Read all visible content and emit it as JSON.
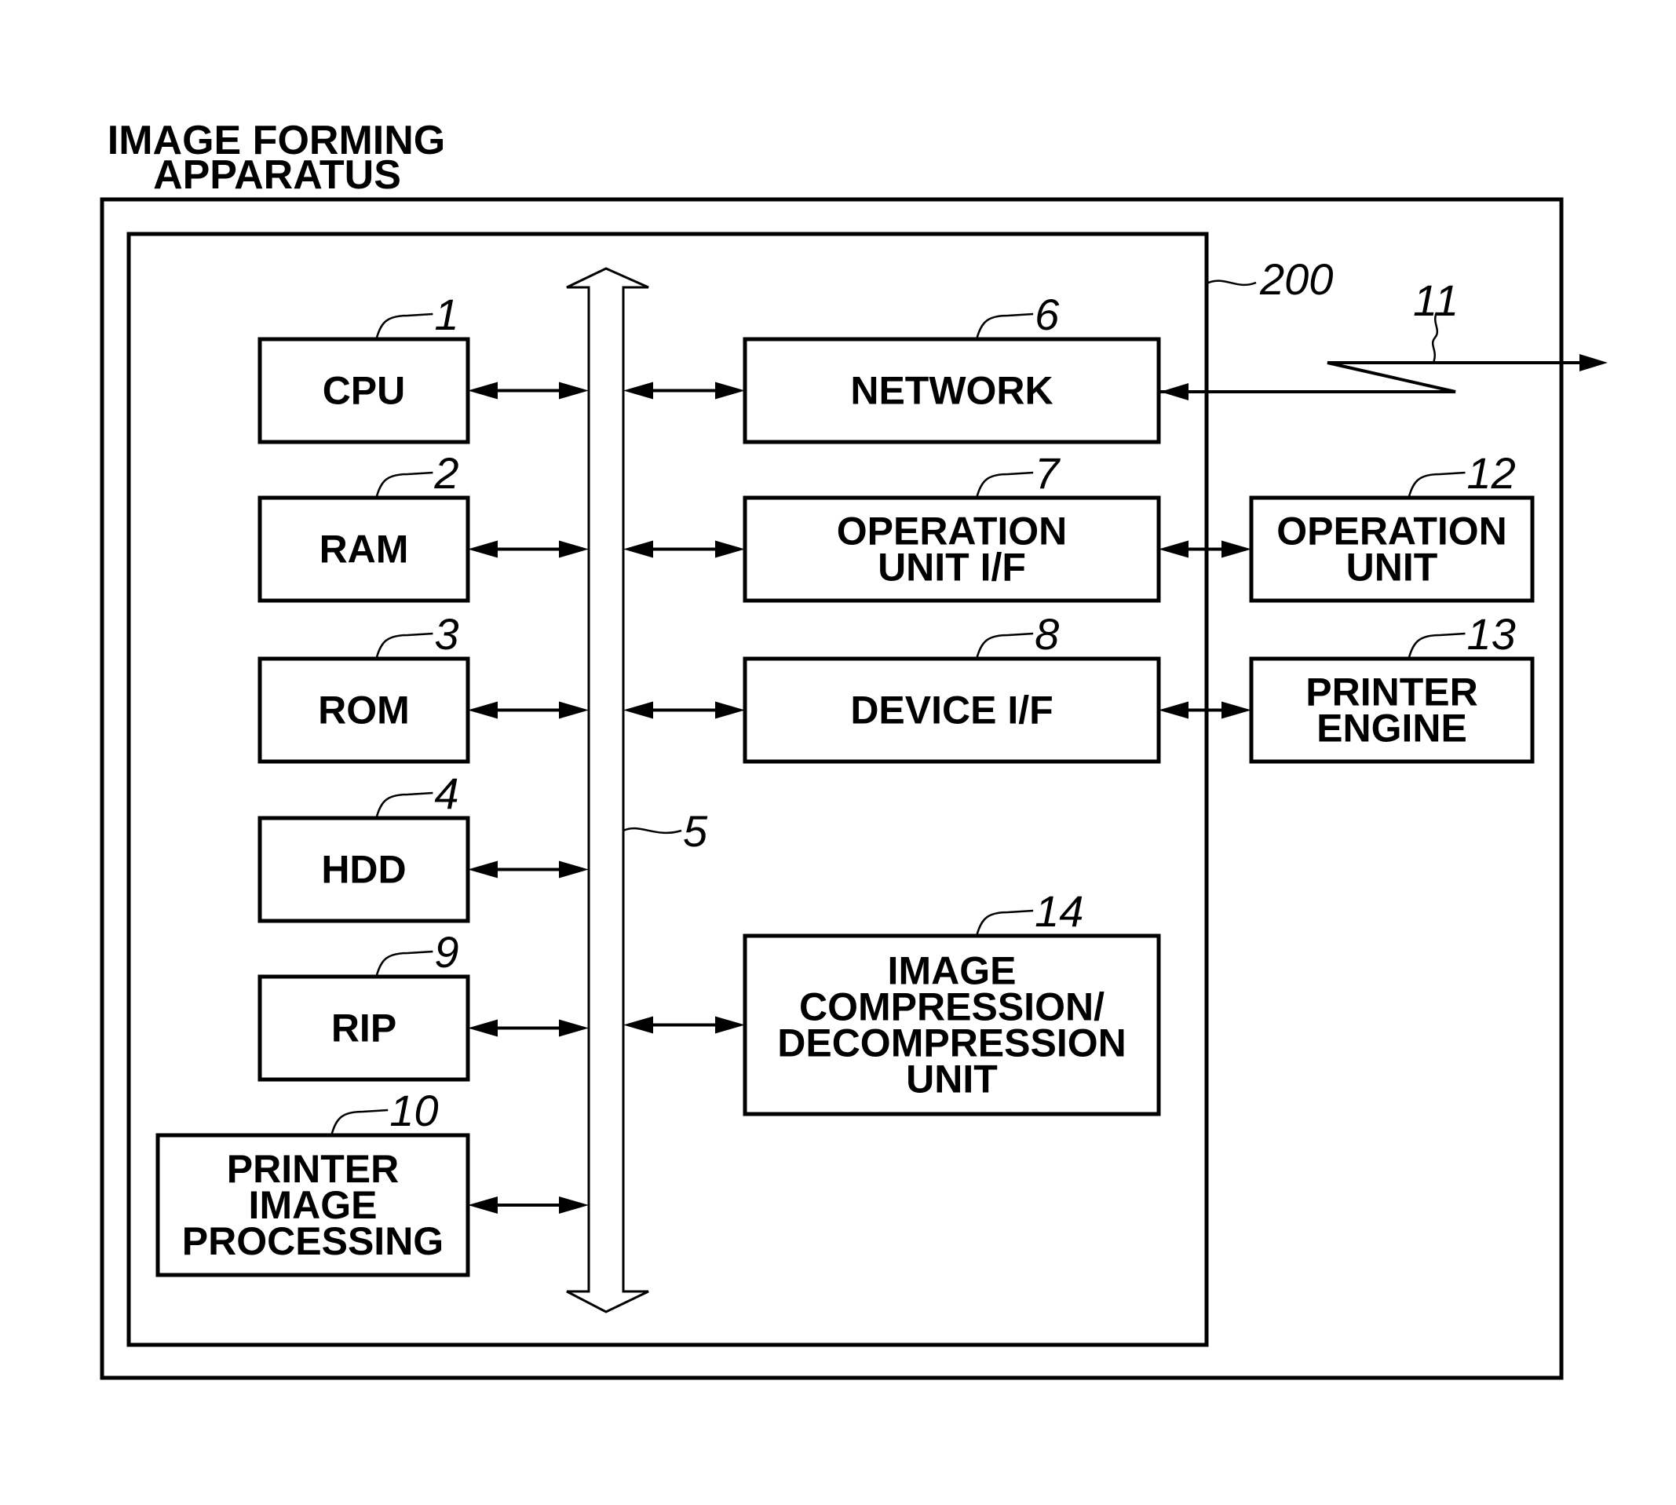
{
  "title": {
    "line1": "IMAGE FORMING",
    "line2": "APPARATUS"
  },
  "controller": {
    "ref": "200"
  },
  "bus": {
    "ref": "5"
  },
  "network_line": {
    "ref": "11"
  },
  "blocks": [
    {
      "id": "cpu",
      "ref": "1",
      "lines": [
        "CPU"
      ]
    },
    {
      "id": "ram",
      "ref": "2",
      "lines": [
        "RAM"
      ]
    },
    {
      "id": "rom",
      "ref": "3",
      "lines": [
        "ROM"
      ]
    },
    {
      "id": "hdd",
      "ref": "4",
      "lines": [
        "HDD"
      ]
    },
    {
      "id": "rip",
      "ref": "9",
      "lines": [
        "RIP"
      ]
    },
    {
      "id": "printer-image-processing",
      "ref": "10",
      "lines": [
        "PRINTER",
        "IMAGE",
        "PROCESSING"
      ]
    },
    {
      "id": "network",
      "ref": "6",
      "lines": [
        "NETWORK"
      ]
    },
    {
      "id": "operation-unit-if",
      "ref": "7",
      "lines": [
        "OPERATION",
        "UNIT I/F"
      ]
    },
    {
      "id": "device-if",
      "ref": "8",
      "lines": [
        "DEVICE I/F"
      ]
    },
    {
      "id": "image-compression-unit",
      "ref": "14",
      "lines": [
        "IMAGE",
        "COMPRESSION/",
        "DECOMPRESSION",
        "UNIT"
      ]
    },
    {
      "id": "operation-unit",
      "ref": "12",
      "lines": [
        "OPERATION",
        "UNIT"
      ]
    },
    {
      "id": "printer-engine",
      "ref": "13",
      "lines": [
        "PRINTER",
        "ENGINE"
      ]
    }
  ],
  "connections": [
    {
      "from": "cpu",
      "to": "bus",
      "type": "bidirectional"
    },
    {
      "from": "ram",
      "to": "bus",
      "type": "bidirectional"
    },
    {
      "from": "rom",
      "to": "bus",
      "type": "bidirectional"
    },
    {
      "from": "hdd",
      "to": "bus",
      "type": "bidirectional"
    },
    {
      "from": "rip",
      "to": "bus",
      "type": "bidirectional"
    },
    {
      "from": "printer-image-processing",
      "to": "bus",
      "type": "bidirectional"
    },
    {
      "from": "bus",
      "to": "network",
      "type": "bidirectional"
    },
    {
      "from": "bus",
      "to": "operation-unit-if",
      "type": "bidirectional"
    },
    {
      "from": "bus",
      "to": "device-if",
      "type": "bidirectional"
    },
    {
      "from": "bus",
      "to": "image-compression-unit",
      "type": "bidirectional"
    },
    {
      "from": "operation-unit-if",
      "to": "operation-unit",
      "type": "bidirectional"
    },
    {
      "from": "device-if",
      "to": "printer-engine",
      "type": "bidirectional"
    },
    {
      "from": "network",
      "to": "external-network",
      "type": "bidirectional"
    }
  ]
}
